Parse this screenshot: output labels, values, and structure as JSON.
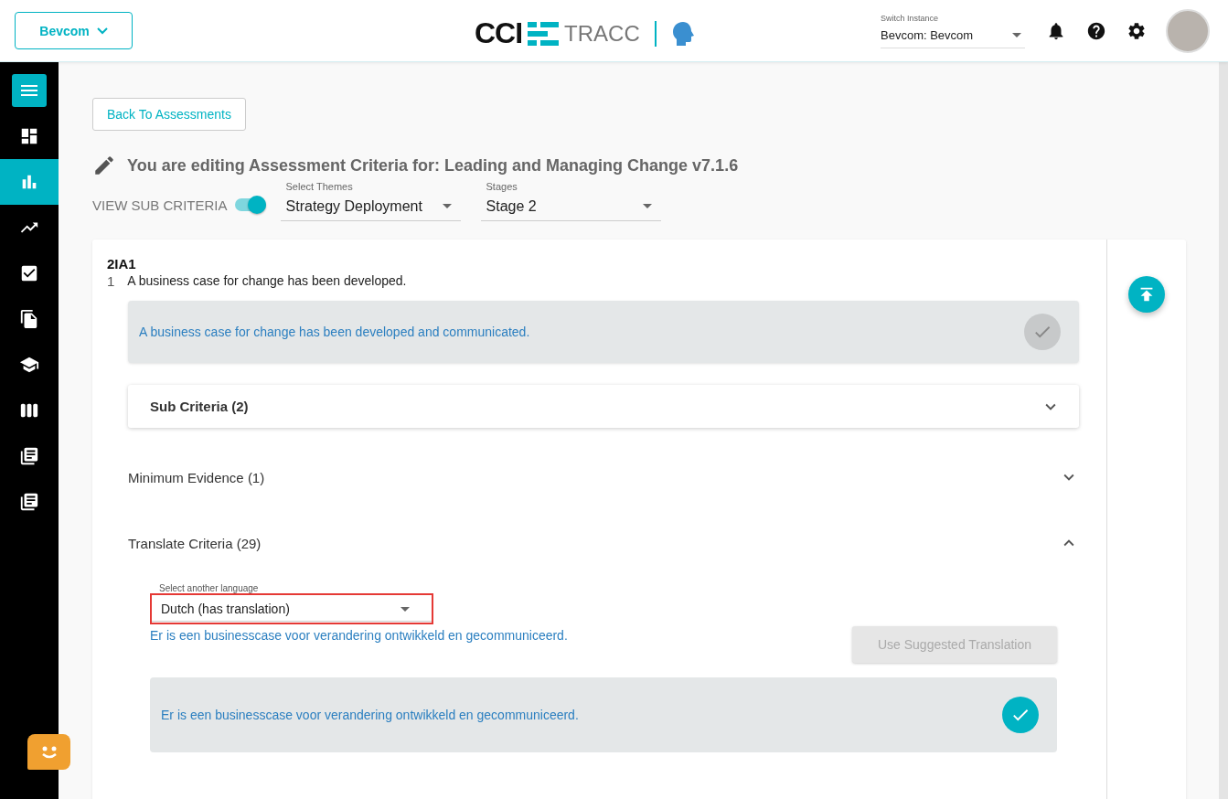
{
  "header": {
    "org_button": "Bevcom",
    "logo": {
      "mark": "CCI",
      "product": "TRACC"
    },
    "instance": {
      "label": "Switch Instance",
      "value": "Bevcom: Bevcom"
    }
  },
  "sidebar": {
    "items": [
      {
        "selected": false
      },
      {
        "selected": true
      },
      {
        "selected": false
      },
      {
        "selected": false
      },
      {
        "selected": false
      },
      {
        "selected": false
      },
      {
        "selected": false
      },
      {
        "selected": false
      },
      {
        "selected": false
      }
    ]
  },
  "back_button": "Back To Assessments",
  "page_title": "You are editing Assessment Criteria for: Leading and Managing Change v7.1.6",
  "filters": {
    "toggle": {
      "label": "VIEW SUB CRITERIA",
      "on": true
    },
    "themes": {
      "label": "Select Themes",
      "value": "Strategy Deployment"
    },
    "stages": {
      "label": "Stages",
      "value": "Stage 2"
    }
  },
  "criterion": {
    "code": "2IA1",
    "number": "1",
    "text": "A business case for change has been developed.",
    "statement": {
      "text": "A business case for change has been developed and communicated.",
      "confirmed": false
    }
  },
  "sections": [
    {
      "title": "Sub Criteria (2)",
      "kind": "card",
      "expanded": false
    },
    {
      "title": "Minimum Evidence (1)",
      "kind": "plain",
      "expanded": false
    },
    {
      "title": "Translate Criteria (29)",
      "kind": "plain",
      "expanded": true,
      "translation": {
        "language": {
          "label": "Select another language",
          "value": "Dutch (has translation)",
          "highlighted": true
        },
        "suggestion": "Er is een businesscase voor verandering ontwikkeld en gecommuniceerd.",
        "suggest_button": {
          "label": "Use Suggested Translation",
          "disabled": true
        },
        "statement": {
          "text": "Er is een businesscase voor verandering ontwikkeld en gecommuniceerd.",
          "confirmed": true
        }
      }
    }
  ]
}
